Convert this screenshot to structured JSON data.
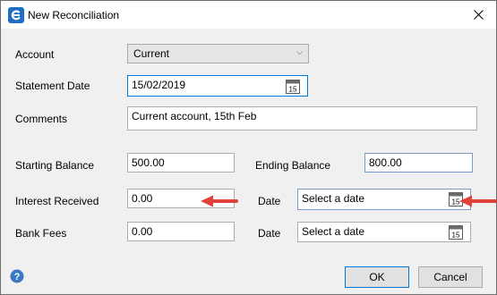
{
  "window": {
    "title": "New Reconciliation",
    "close_label": "✕"
  },
  "form": {
    "account": {
      "label": "Account",
      "value": "Current"
    },
    "statement_date": {
      "label": "Statement Date",
      "value": "15/02/2019",
      "calendar_day": "15"
    },
    "comments": {
      "label": "Comments",
      "value": "Current account, 15th Feb"
    },
    "starting_balance": {
      "label": "Starting Balance",
      "value": "500.00"
    },
    "ending_balance": {
      "label": "Ending Balance",
      "value": "800.00"
    },
    "interest_received": {
      "label": "Interest Received",
      "value": "0.00"
    },
    "interest_date": {
      "label": "Date",
      "placeholder": "Select a date",
      "calendar_day": "15"
    },
    "bank_fees": {
      "label": "Bank Fees",
      "value": "0.00"
    },
    "fees_date": {
      "label": "Date",
      "placeholder": "Select a date",
      "calendar_day": "15"
    }
  },
  "footer": {
    "help_glyph": "?",
    "ok_label": "OK",
    "cancel_label": "Cancel"
  },
  "colors": {
    "annotation_arrow": "#e0423a",
    "focus_border": "#0078d7",
    "app_icon": "#1e6fc0"
  }
}
